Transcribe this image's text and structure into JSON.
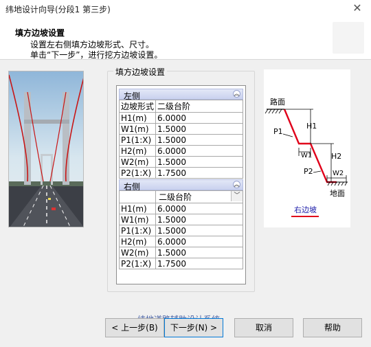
{
  "window": {
    "title": "纬地设计向导(分段1 第三步)",
    "close_label": "✕"
  },
  "header": {
    "title": "填方边坡设置",
    "line1": "设置左右侧填方边坡形式、尺寸。",
    "line2": "单击“下一步”，进行挖方边坡设置。"
  },
  "group": {
    "legend": "填方边坡设置"
  },
  "left": {
    "label": "左侧",
    "toggle_icon": "collapse-icon",
    "form_label": "边坡形式",
    "form_value": "二级台阶",
    "rows": [
      {
        "key": "H1(m)",
        "value": "6.0000"
      },
      {
        "key": "W1(m)",
        "value": "1.5000"
      },
      {
        "key": "P1(1:X)",
        "value": "1.5000"
      },
      {
        "key": "H2(m)",
        "value": "6.0000"
      },
      {
        "key": "W2(m)",
        "value": "1.5000"
      },
      {
        "key": "P2(1:X)",
        "value": "1.7500"
      }
    ]
  },
  "right": {
    "label": "右侧",
    "toggle_icon": "collapse-icon",
    "form_value": "二级台阶",
    "rows": [
      {
        "key": "H1(m)",
        "value": "6.0000"
      },
      {
        "key": "W1(m)",
        "value": "1.5000"
      },
      {
        "key": "P1(1:X)",
        "value": "1.5000"
      },
      {
        "key": "H2(m)",
        "value": "6.0000"
      },
      {
        "key": "W2(m)",
        "value": "1.5000"
      },
      {
        "key": "P2(1:X)",
        "value": "1.7500"
      }
    ]
  },
  "diagram": {
    "road": "路面",
    "ground": "地面",
    "p1": "P1",
    "p2": "P2",
    "h1": "H1",
    "h2": "H2",
    "w1": "W1",
    "w2": "W2",
    "caption": "右边坡",
    "line_color": "#e0001a",
    "caption_color": "#1a1aa8"
  },
  "footer": {
    "watermark": "纬地道路辅助设计系统",
    "back": "< 上一步(B)",
    "next": "下一步(N) >",
    "cancel": "取消",
    "help": "帮助"
  }
}
